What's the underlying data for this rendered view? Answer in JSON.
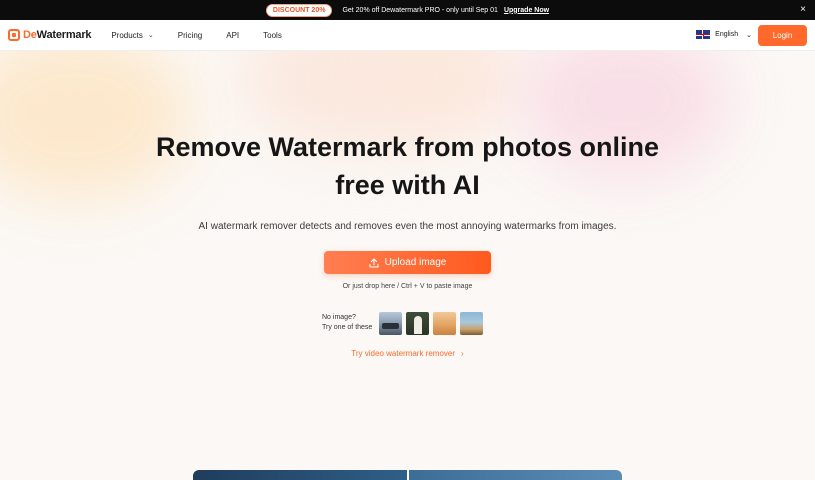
{
  "promo": {
    "badge": "DISCOUNT 20%",
    "text": "Get 20% off Dewatermark PRO - only until Sep 01",
    "link": "Upgrade Now",
    "close": "×"
  },
  "header": {
    "logo_prefix": "De",
    "logo_suffix": "Watermark",
    "nav": {
      "products": "Products",
      "pricing": "Pricing",
      "api": "API",
      "tools": "Tools"
    },
    "language": "English",
    "login": "Login"
  },
  "hero": {
    "title_line1": "Remove Watermark from photos online",
    "title_line2": "free with AI",
    "subtitle": "AI watermark remover detects and removes even the most annoying watermarks from images.",
    "upload_label": "Upload image",
    "drop_hint": "Or just drop here / Ctrl + V to paste image",
    "samples_label_line1": "No image?",
    "samples_label_line2": "Try one of these",
    "video_link": "Try video watermark remover"
  },
  "colors": {
    "accent": "#ff6a2c",
    "promo_bg": "#0c0c0c"
  }
}
